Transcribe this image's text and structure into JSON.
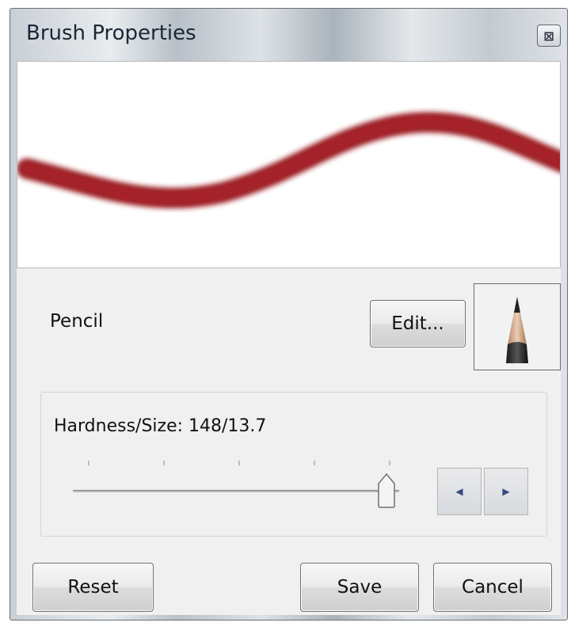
{
  "window": {
    "title": "Brush Properties",
    "close_glyph": "⊠"
  },
  "preview": {
    "stroke_color": "#9b1b24"
  },
  "brush": {
    "name": "Pencil",
    "edit_label": "Edit...",
    "icon": "pencil-icon"
  },
  "hardness": {
    "label": "Hardness/Size:  148/13.7",
    "slider_value_fraction": 0.96,
    "tick_count": 5,
    "decrement_icon": "arrow-left-icon",
    "increment_icon": "arrow-right-icon"
  },
  "buttons": {
    "reset": "Reset",
    "save": "Save",
    "cancel": "Cancel"
  }
}
